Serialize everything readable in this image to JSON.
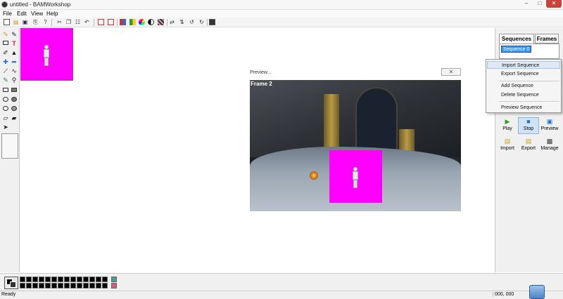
{
  "window": {
    "title": "untitled - BAMWorkshop"
  },
  "menu": [
    "File",
    "Edit",
    "View",
    "Help"
  ],
  "toolbar_icons": [
    "new-icon",
    "open-icon",
    "save-icon",
    "print-icon",
    "help-icon",
    "cut-icon",
    "copy-icon",
    "paste-icon",
    "undo-icon",
    "frame-icon",
    "frame-alt-icon",
    "palette-icon",
    "tiles-icon",
    "color-wheel-icon",
    "contrast-icon",
    "pattern-icon",
    "flip-horizontal-icon",
    "flip-vertical-icon",
    "rotate-left-icon",
    "rotate-right-icon",
    "stop-record-icon"
  ],
  "tools": [
    "eraser-icon",
    "select-icon",
    "rectangle-select-icon",
    "text-icon",
    "pencil-icon",
    "fill-icon",
    "move-icon",
    "replace-icon",
    "line-icon",
    "curve-icon",
    "eyedropper-icon",
    "zoom-icon",
    "rectangle-icon",
    "filled-rectangle-icon",
    "ellipse-icon",
    "filled-ellipse-icon",
    "ellipse-outline-icon",
    "filled-ellipse-alt-icon",
    "polygon-icon",
    "filled-polygon-icon",
    "pointer-icon"
  ],
  "preview": {
    "title": "Preview...",
    "frame_label": "Frame 2"
  },
  "right_panel": {
    "tabs": [
      "Sequences",
      "Frames"
    ],
    "sequences": [
      "Sequence 0"
    ],
    "context_menu": [
      "Import Sequence",
      "Export Sequence",
      "Add Sequence",
      "Delete Sequence",
      "Preview Sequence"
    ],
    "controls": [
      {
        "label": "Play",
        "icon": "play-icon"
      },
      {
        "label": "Stop",
        "icon": "stop-icon"
      },
      {
        "label": "Preview",
        "icon": "preview-icon"
      }
    ],
    "actions": [
      {
        "label": "Import",
        "icon": "import-folder-icon"
      },
      {
        "label": "Export",
        "icon": "export-folder-icon"
      },
      {
        "label": "Manage",
        "icon": "manage-icon"
      }
    ]
  },
  "status": {
    "text": "Ready",
    "coords": "000, 000"
  },
  "colors": {
    "magenta": "#ff00ff",
    "selection": "#3399ff",
    "accent_teal": "#4a9a9a",
    "accent_pink": "#d85a78"
  }
}
